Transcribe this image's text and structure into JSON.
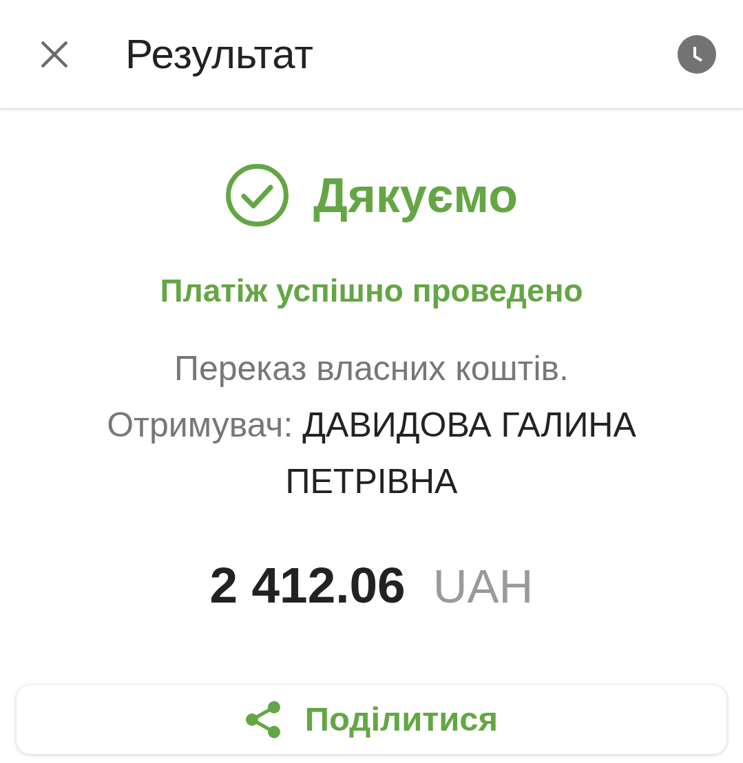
{
  "header": {
    "title": "Результат"
  },
  "status": {
    "kind": "success",
    "heading": "Дякуємо",
    "message": "Платіж успішно проведено"
  },
  "details": {
    "description": "Переказ власних коштів.",
    "recipient_label": "Отримувач:",
    "recipient_name": "ДАВИДОВА ГАЛИНА ПЕТРІВНА"
  },
  "amount": {
    "value": "2 412.06",
    "currency": "UAH"
  },
  "actions": [
    {
      "kind": "share",
      "label": "Поділитися"
    }
  ]
}
